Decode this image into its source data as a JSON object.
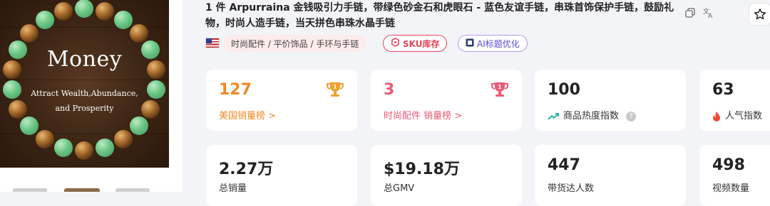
{
  "product": {
    "image": {
      "title": "Money",
      "subtitle_line1": "Attract Wealth,Abundance,",
      "subtitle_line2": "and Prosperity"
    },
    "title": "1 件 Arpurraina 金钱吸引力手链，带绿色砂金石和虎眼石 - 蓝色友谊手链，串珠首饰保护手链，鼓励礼物，时尚人造手链，当天拼色串珠水晶手链",
    "icons": {
      "copy": "copy-icon",
      "translate": "translate-icon",
      "favorite": "star-icon"
    }
  },
  "tags": {
    "country_flag": "us-flag-icon",
    "category": "时尚配件 / 平价饰品 / 手环与手链",
    "sku": "SKU库存",
    "ai": "AI标题优化"
  },
  "stats": [
    {
      "value": "127",
      "label": "美国销量榜 >",
      "color": "#f08a24"
    },
    {
      "value": "3",
      "label": "时尚配件 销量榜 >",
      "color": "#ea5b73"
    },
    {
      "value": "100",
      "label": "商品热度指数"
    },
    {
      "value": "63",
      "label": "人气指数"
    },
    {
      "value": "2.27万",
      "label": "总销量"
    },
    {
      "value": "$19.18万",
      "label": "总GMV"
    },
    {
      "value": "447",
      "label": "带货达人数"
    },
    {
      "value": "498",
      "label": "视频数量"
    }
  ]
}
